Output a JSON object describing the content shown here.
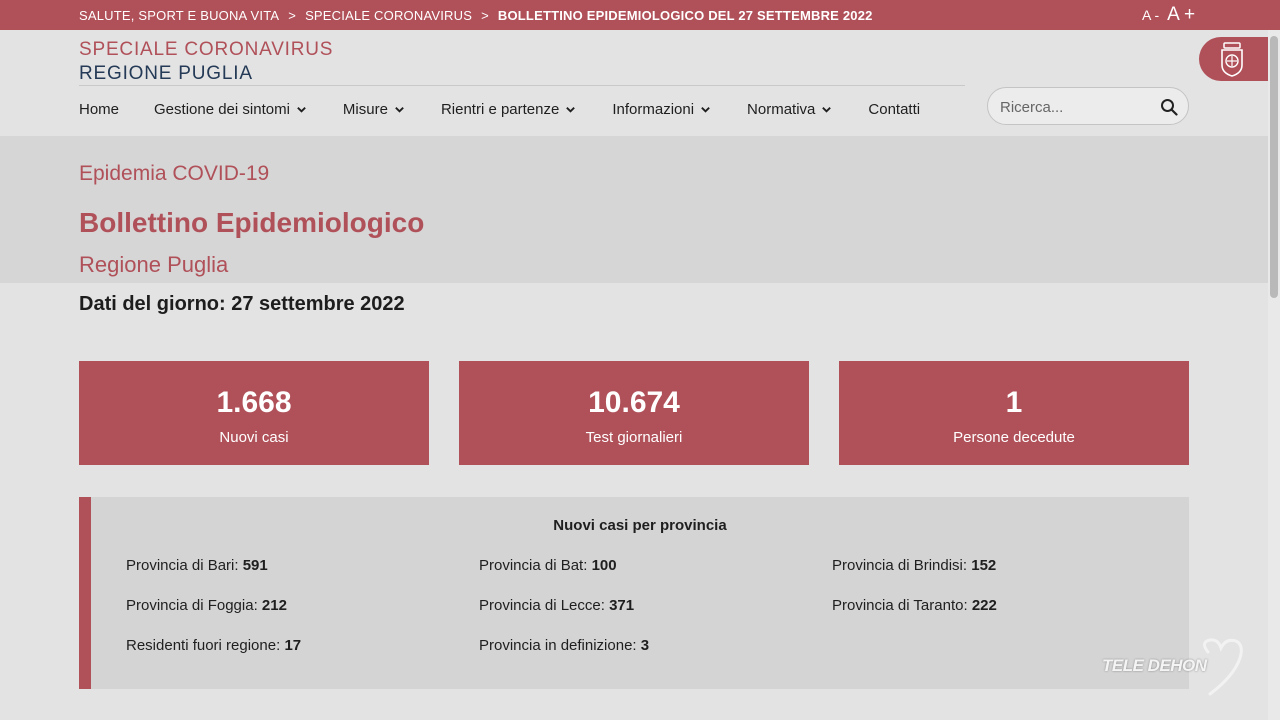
{
  "breadcrumb": {
    "items": [
      "SALUTE, SPORT E BUONA VITA",
      "SPECIALE CORONAVIRUS"
    ],
    "separator": ">",
    "current": "BOLLETTINO EPIDEMIOLOGICO DEL 27 SETTEMBRE 2022"
  },
  "font_controls": {
    "decrease": "A -",
    "increase": "A +"
  },
  "header": {
    "brand_line1": "SPECIALE CORONAVIRUS",
    "brand_line2": "REGIONE PUGLIA"
  },
  "nav": [
    {
      "label": "Home",
      "dropdown": false
    },
    {
      "label": "Gestione dei sintomi",
      "dropdown": true
    },
    {
      "label": "Misure",
      "dropdown": true
    },
    {
      "label": "Rientri e partenze",
      "dropdown": true
    },
    {
      "label": "Informazioni",
      "dropdown": true
    },
    {
      "label": "Normativa",
      "dropdown": true
    },
    {
      "label": "Contatti",
      "dropdown": false
    }
  ],
  "search": {
    "placeholder": "Ricerca..."
  },
  "hero": {
    "eyebrow": "Epidemia COVID-19",
    "title": "Bollettino Epidemiologico",
    "subtitle": "Regione Puglia"
  },
  "date_line": "Dati del giorno: 27 settembre 2022",
  "stats": [
    {
      "value": "1.668",
      "label": "Nuovi casi"
    },
    {
      "value": "10.674",
      "label": "Test giornalieri"
    },
    {
      "value": "1",
      "label": "Persone decedute"
    }
  ],
  "provinces": {
    "title": "Nuovi casi per provincia",
    "items": [
      {
        "label": "Provincia di Bari:",
        "value": "591"
      },
      {
        "label": "Provincia di Bat:",
        "value": "100"
      },
      {
        "label": "Provincia di Brindisi:",
        "value": "152"
      },
      {
        "label": "Provincia di Foggia:",
        "value": "212"
      },
      {
        "label": "Provincia di Lecce:",
        "value": "371"
      },
      {
        "label": "Provincia di Taranto:",
        "value": "222"
      },
      {
        "label": "Residenti fuori regione:",
        "value": "17"
      },
      {
        "label": "Provincia in definizione:",
        "value": "3"
      }
    ]
  },
  "watermark": "TELE DEHON",
  "colors": {
    "accent": "#b05059",
    "navy": "#243a56",
    "background": "#e3e3e3"
  },
  "icons": {
    "search": "search-icon",
    "dropdown": "chevron-down-icon",
    "emblem": "region-emblem-icon"
  }
}
